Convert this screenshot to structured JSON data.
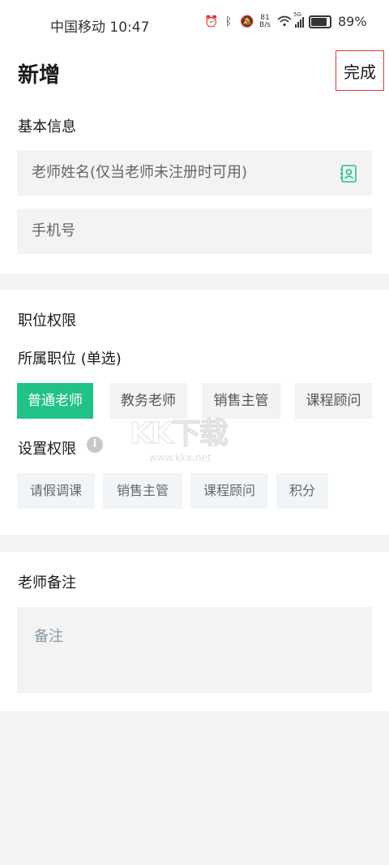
{
  "status_bar": {
    "carrier_time": "中国移动 10:47",
    "net_speed_value": "81",
    "net_speed_unit": "B/s",
    "network_tag": "5G",
    "battery_level": 0.89,
    "battery_text": "89%"
  },
  "header": {
    "title": "新增",
    "done_label": "完成"
  },
  "basic_info": {
    "section_title": "基本信息",
    "teacher_name_placeholder": "老师姓名(仅当老师未注册时可用)",
    "phone_placeholder": "手机号"
  },
  "position": {
    "section_title": "职位权限",
    "position_label": "所属职位 (单选)",
    "positions": [
      {
        "label": "普通老师",
        "selected": true
      },
      {
        "label": "教务老师",
        "selected": false
      },
      {
        "label": "销售主管",
        "selected": false
      },
      {
        "label": "课程顾问",
        "selected": false
      }
    ],
    "permission_label": "设置权限",
    "info_glyph": "i",
    "permissions": [
      "请假调课",
      "销售主管",
      "课程顾问",
      "积分"
    ]
  },
  "remarks": {
    "section_title": "老师备注",
    "remark_placeholder": "备注"
  },
  "watermark": {
    "brand": "KK下载",
    "url": "www.kkx.net"
  },
  "colors": {
    "accent_green": "#21c286",
    "highlight_box": "#e0392b"
  },
  "icons": {
    "contact": "contact-card-icon",
    "info": "info-icon"
  }
}
